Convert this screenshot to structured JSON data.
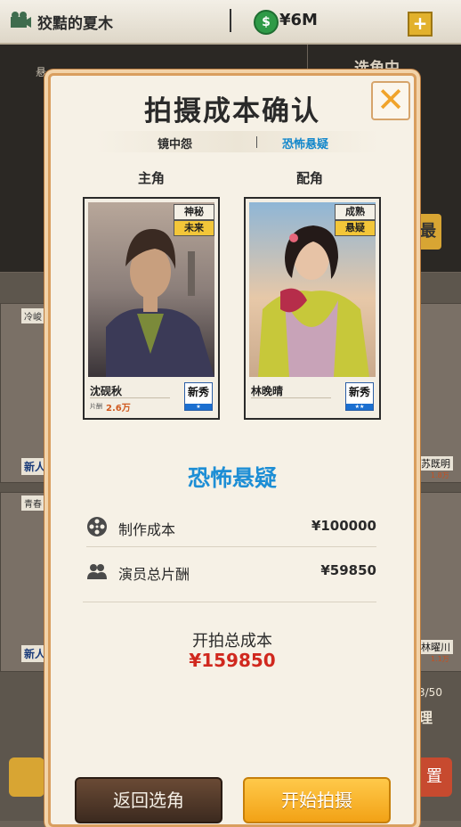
{
  "topbar": {
    "title": "狡黠的夏木",
    "money": "¥6M",
    "coin_icon": "dollar-coin-icon",
    "plus_icon": "plus-icon"
  },
  "background": {
    "text_top_left": "悬",
    "text_top_right": "选角中",
    "tags": [
      "冷峻",
      "青春"
    ],
    "new_label": "新人",
    "right_names": [
      "苏既明",
      "林曜川"
    ],
    "right_fees": [
      "1.8万",
      "1.1万"
    ],
    "count": "3/50",
    "manage_label": "理",
    "side_btn": "置",
    "search_btn": "最"
  },
  "dialog": {
    "title": "拍摄成本确认",
    "script_name": "镜中怨",
    "genre": "恐怖悬疑",
    "lead_label": "主角",
    "support_label": "配角",
    "lead": {
      "name": "沈砚秋",
      "tags": [
        "神秘",
        "未来"
      ],
      "fee_label": "片酬",
      "fee": "2.6万",
      "badge": "新秀"
    },
    "support": {
      "name": "林晚晴",
      "tags": [
        "成熟",
        "悬疑"
      ],
      "fee_label": "",
      "fee": "",
      "badge": "新秀"
    },
    "genre_title": "恐怖悬疑",
    "production_cost_label": "制作成本",
    "production_cost": "¥100000",
    "actor_fee_label": "演员总片酬",
    "actor_fee": "¥59850",
    "total_label": "开拍总成本",
    "total_value": "¥159850",
    "back_button": "返回选角",
    "start_button": "开始拍摄"
  },
  "colors": {
    "accent_blue": "#1d8ed5",
    "total_red": "#d0281e",
    "start_orange": "#f2a216",
    "back_brown": "#4b3425"
  }
}
